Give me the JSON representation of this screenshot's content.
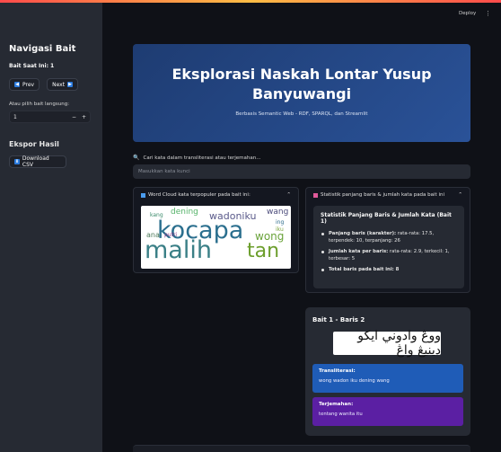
{
  "header": {
    "deploy_label": "Deploy",
    "menu_icon": "kebab-menu-icon"
  },
  "sidebar": {
    "title": "Navigasi Bait",
    "current": "Bait Saat Ini: 1",
    "prev_label": "Prev",
    "next_label": "Next",
    "select_label": "Atau pilih bait langsung:",
    "select_value": "1",
    "minus": "−",
    "plus": "+",
    "export_title": "Ekspor Hasil",
    "download_label": "Download CSV"
  },
  "hero": {
    "title": "Eksplorasi Naskah Lontar Yusup Banyuwangi",
    "subtitle": "Berbasis Semantic Web - RDF, SPARQL, dan Streamlit"
  },
  "search": {
    "label": "Cari kata dalam transliterasi atau terjemahan...",
    "placeholder": "Masukkan kata kunci"
  },
  "wordcloud": {
    "title": "Word Cloud kata terpopuler pada bait ini:",
    "words": [
      "kocapa",
      "malih",
      "tan",
      "wadoniku",
      "dening",
      "wong",
      "wang",
      "ana",
      "putri",
      "kang",
      "ing",
      "iku"
    ]
  },
  "stats": {
    "panel_title": "Statistik panjang baris & jumlah kata pada bait ini",
    "title": "Statistik Panjang Baris & Jumlah Kata (Bait 1)",
    "item1_label": "Panjang baris (karakter):",
    "item1_value": "rata-rata: 17.5, terpendek: 10, terpanjang: 26",
    "item2_label": "Jumlah kata per baris:",
    "item2_value": "rata-rata: 2.9, terkecil: 1, terbesar: 5",
    "item3_label": "Total baris pada bait ini: 8"
  },
  "card": {
    "title": "Bait 1 - Baris 2",
    "arabic": "ووڠ وادوني ايكو دينيڠ واڠ",
    "translit_label": "Transliterasi:",
    "translit_text": "wong wadon iku dening wang",
    "translation_label": "Terjemahan:",
    "translation_text": "tentang wanita itu"
  }
}
